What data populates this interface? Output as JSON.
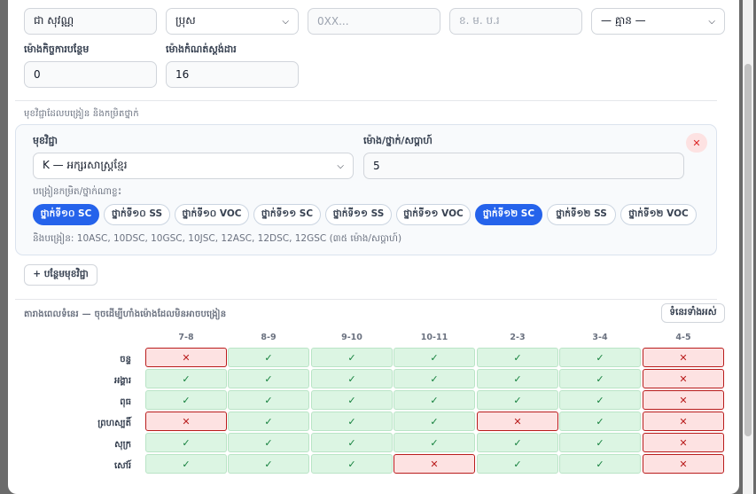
{
  "form": {
    "name_value": "ជា សុវណ្ណ",
    "gender_value": "ប្រុស",
    "phone_placeholder": "0XX...",
    "dob_placeholder": "ខ. ម. ប.រ",
    "homeroom_value": "— គ្មាន —",
    "extra_hours_label": "ម៉ោងកិច្ចការបន្ថែម",
    "extra_hours_value": "0",
    "standard_hours_label": "ម៉ោងកំណត់ស្តង់ដារ",
    "standard_hours_value": "16"
  },
  "subjects": {
    "section_title": "មុខវិជ្ជាដែលបង្រៀន និងកម្រិតថ្នាក់",
    "subject_label": "មុខវិជ្ជា",
    "subject_value": "K — អក្សរសាស្ត្រខ្មែរ",
    "hours_label": "ម៉ោង/ថ្នាក់/សប្តាហ៍",
    "hours_value": "5",
    "levels_label": "បង្រៀនកម្រិត/ថ្នាក់ណាខ្លះ",
    "chips": [
      {
        "label": "ថ្នាក់ទី១០ SC",
        "on": true
      },
      {
        "label": "ថ្នាក់ទី១០ SS",
        "on": false
      },
      {
        "label": "ថ្នាក់ទី១០ VOC",
        "on": false
      },
      {
        "label": "ថ្នាក់ទី១១ SC",
        "on": false
      },
      {
        "label": "ថ្នាក់ទី១១ SS",
        "on": false
      },
      {
        "label": "ថ្នាក់ទី១១ VOC",
        "on": false
      },
      {
        "label": "ថ្នាក់ទី១២ SC",
        "on": true
      },
      {
        "label": "ថ្នាក់ទី១២ SS",
        "on": false
      },
      {
        "label": "ថ្នាក់ទី១២ VOC",
        "on": false
      }
    ],
    "will_teach_note": "និងបង្រៀន: 10ASC, 10DSC, 10GSC, 10JSC, 12ASC, 12DSC, 12GSC (៣៥ ម៉ោង/សប្តាហ៍)",
    "add_subject_button": "+ បន្ថែមមុខវិជ្ជា",
    "close_icon": "close-icon"
  },
  "schedule": {
    "section_title": "តារាងពេលទំនេរ — ចុចដើម្បីហាំងម៉ោងដែលមិនអាចបង្រៀន",
    "all_free_button": "ទំនេរទាំងអស់",
    "periods": [
      "7-8",
      "8-9",
      "9-10",
      "10-11",
      "2-3",
      "3-4",
      "4-5"
    ],
    "days": [
      {
        "name": "ចន្ទ",
        "slots": [
          0,
          1,
          1,
          1,
          1,
          1,
          0
        ]
      },
      {
        "name": "អង្គារ",
        "slots": [
          1,
          1,
          1,
          1,
          1,
          1,
          0
        ]
      },
      {
        "name": "ពុធ",
        "slots": [
          1,
          1,
          1,
          1,
          1,
          1,
          0
        ]
      },
      {
        "name": "ព្រហស្បតិ៍",
        "slots": [
          0,
          1,
          1,
          1,
          0,
          1,
          0
        ]
      },
      {
        "name": "សុក្រ",
        "slots": [
          1,
          1,
          1,
          1,
          1,
          1,
          0
        ]
      },
      {
        "name": "សៅរ៍",
        "slots": [
          1,
          1,
          1,
          0,
          1,
          1,
          0
        ]
      }
    ],
    "ok_symbol": "✓",
    "no_symbol": "✕"
  }
}
